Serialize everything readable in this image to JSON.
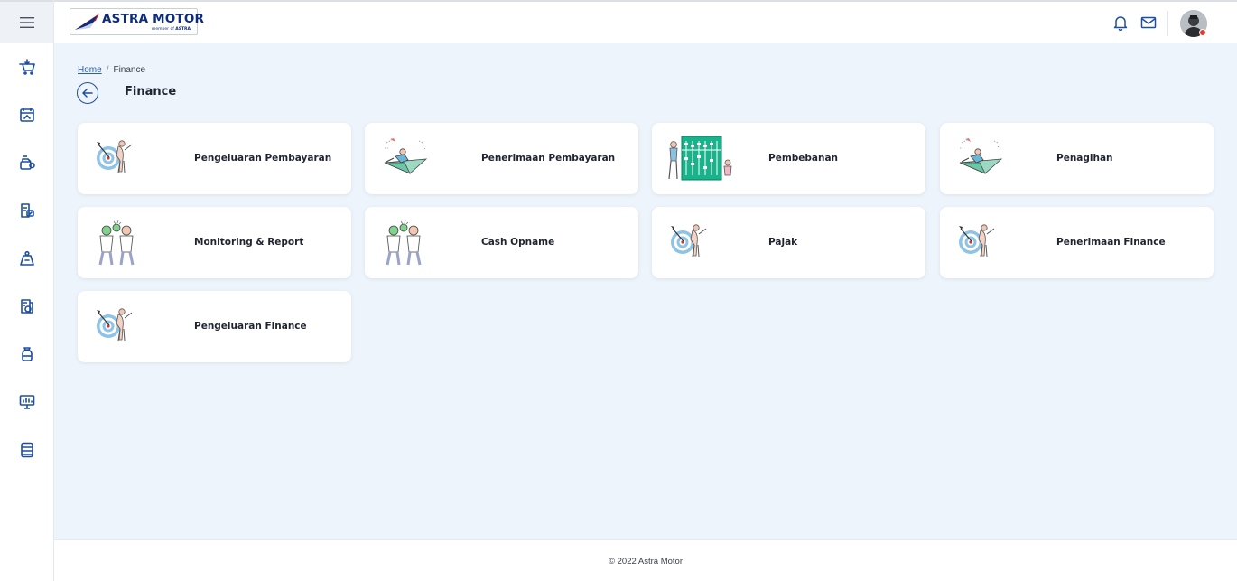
{
  "brand": {
    "name": "ASTRA MOTOR",
    "tagline_prefix": "member of",
    "tagline_brand": "ASTRA"
  },
  "breadcrumb": {
    "home": "Home",
    "separator": "/",
    "current": "Finance"
  },
  "page": {
    "title": "Finance"
  },
  "sidebar": {
    "items": [
      {
        "icon": "cart-icon"
      },
      {
        "icon": "calendar-icon"
      },
      {
        "icon": "vehicle-service-icon"
      },
      {
        "icon": "document-check-icon"
      },
      {
        "icon": "scale-icon"
      },
      {
        "icon": "receipt-icon"
      },
      {
        "icon": "money-bag-icon"
      },
      {
        "icon": "presentation-icon"
      },
      {
        "icon": "database-icon"
      }
    ]
  },
  "header": {
    "icons": [
      "bell-icon",
      "mail-icon"
    ]
  },
  "cards": [
    {
      "label": "Pengeluaran Pembayaran",
      "illustration": "target-illustration"
    },
    {
      "label": "Penerimaan Pembayaran",
      "illustration": "paper-plane-illustration"
    },
    {
      "label": "Pembebanan",
      "illustration": "abacus-illustration"
    },
    {
      "label": "Penagihan",
      "illustration": "paper-plane-illustration"
    },
    {
      "label": "Monitoring & Report",
      "illustration": "team-illustration"
    },
    {
      "label": "Cash Opname",
      "illustration": "team-illustration"
    },
    {
      "label": "Pajak",
      "illustration": "target-illustration"
    },
    {
      "label": "Penerimaan Finance",
      "illustration": "target-illustration"
    },
    {
      "label": "Pengeluaran Finance",
      "illustration": "target-illustration"
    }
  ],
  "footer": {
    "text": "© 2022 Astra Motor"
  },
  "colors": {
    "brand_blue": "#0d2c7d",
    "accent_blue": "#1d4f9e",
    "background": "#eef4fc"
  }
}
